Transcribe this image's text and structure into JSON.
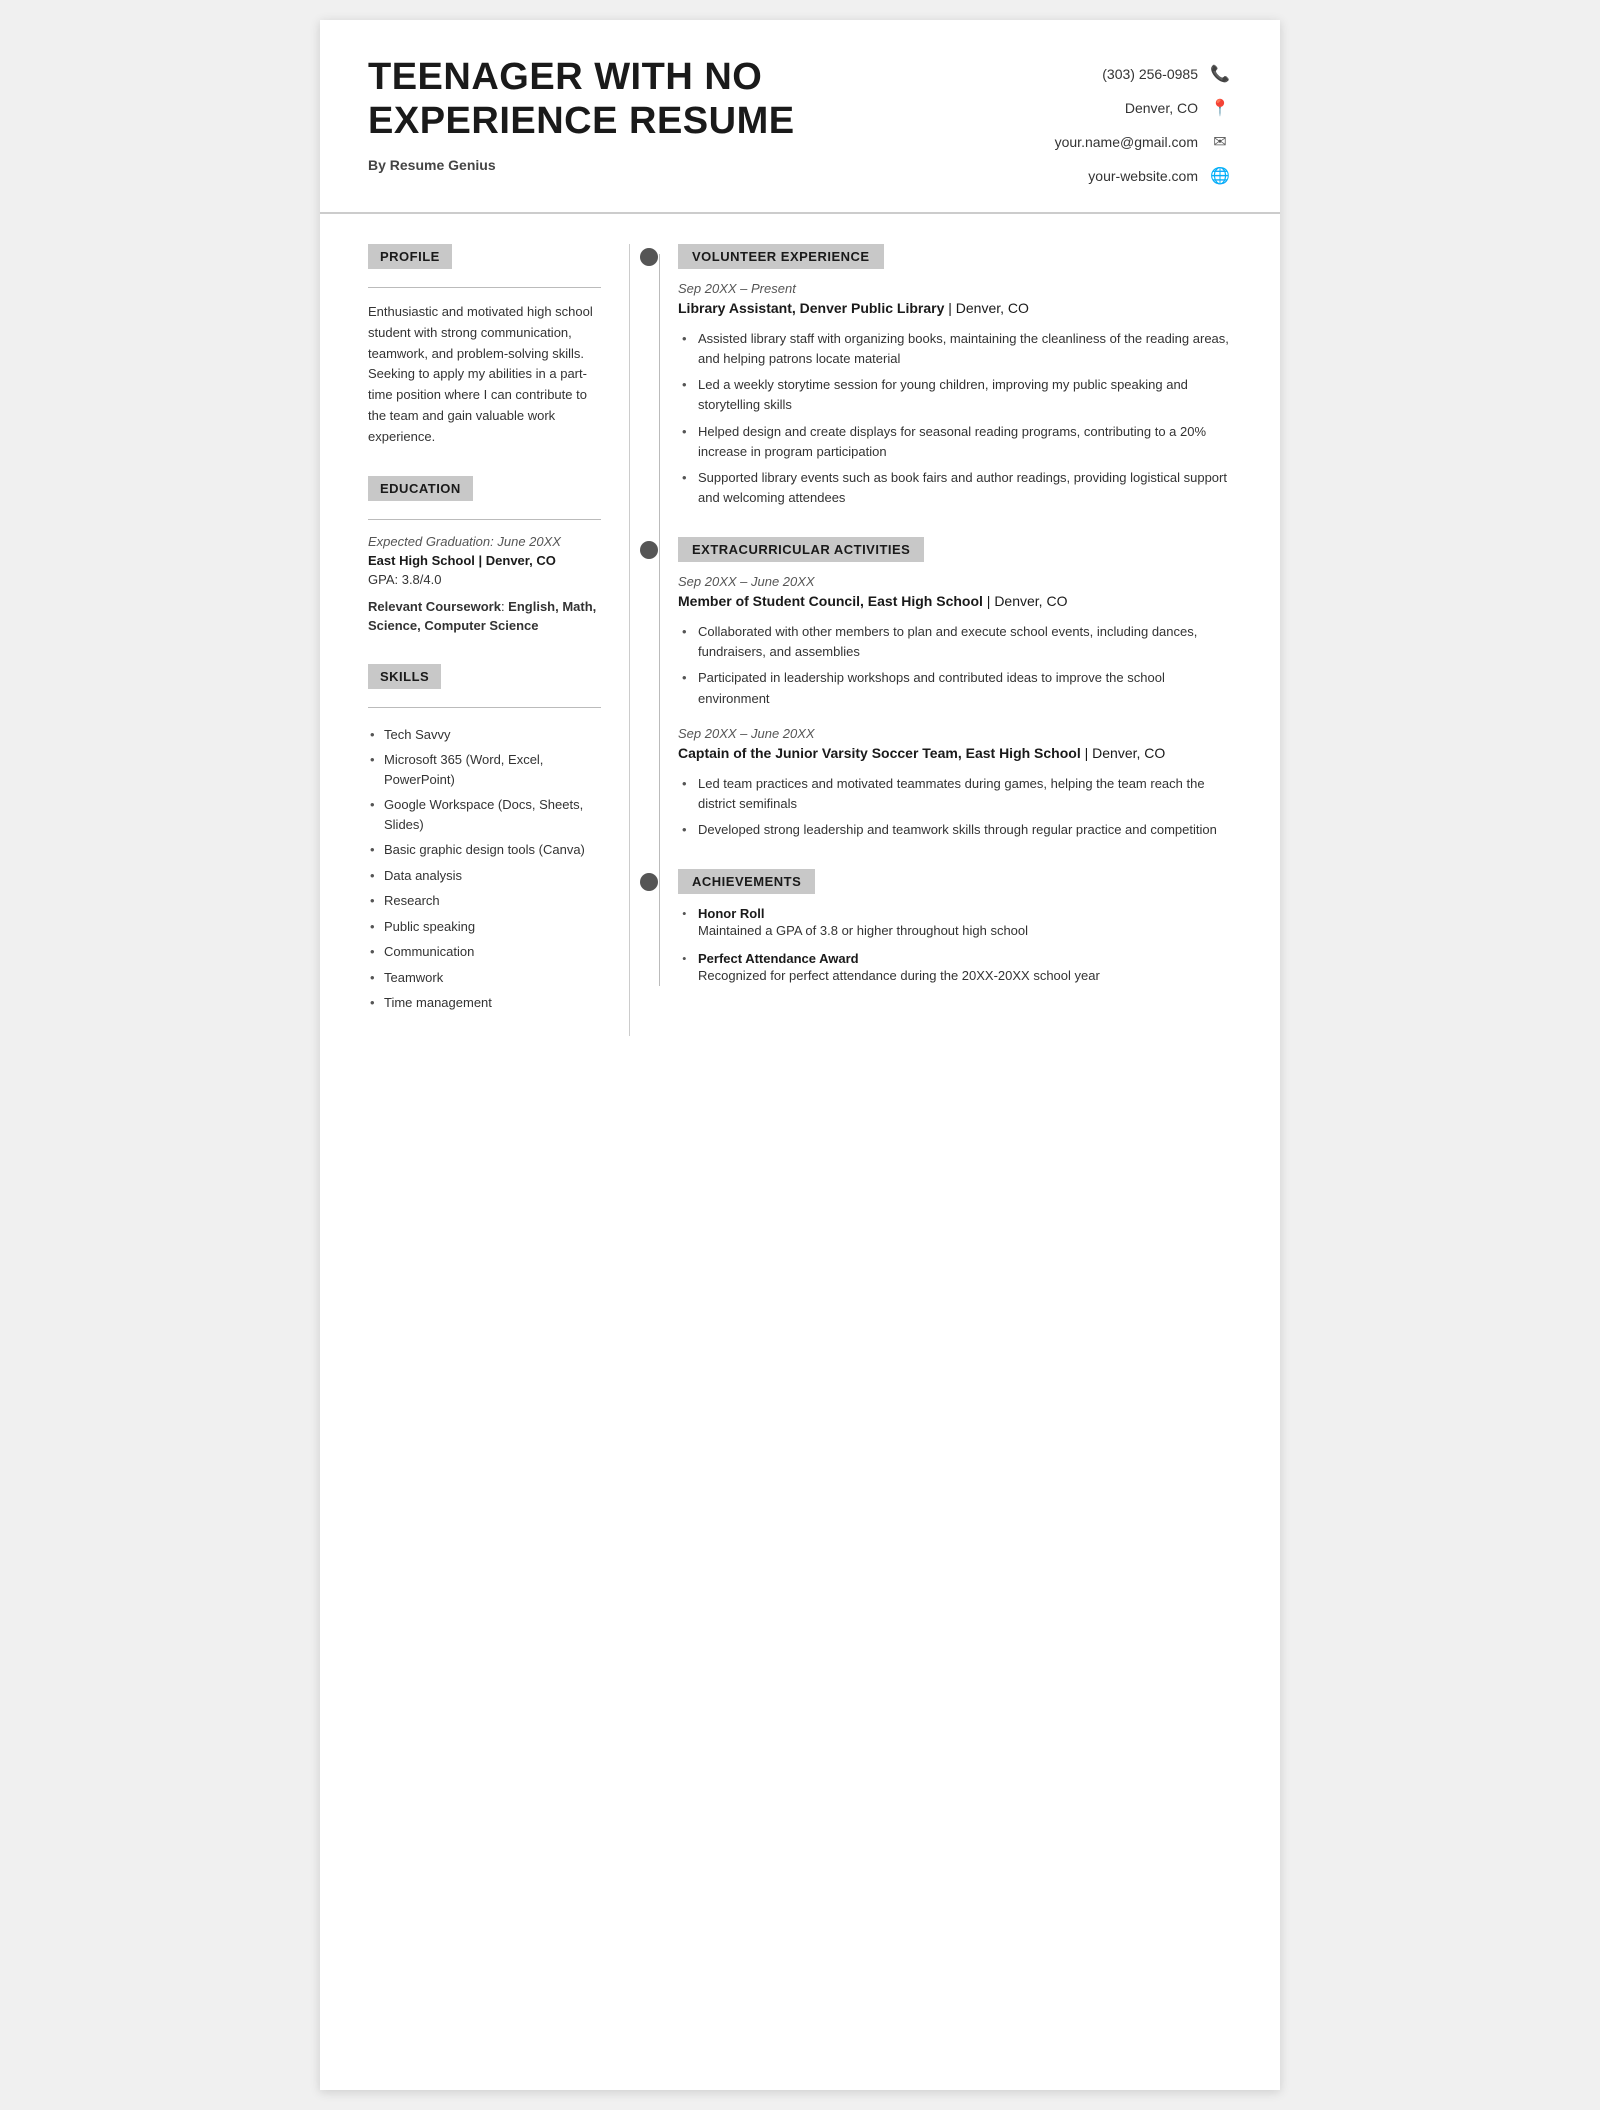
{
  "header": {
    "title": "TEENAGER WITH NO EXPERIENCE RESUME",
    "byline": "By Resume Genius",
    "contact": {
      "phone": "(303) 256-0985",
      "location": "Denver, CO",
      "email": "your.name@gmail.com",
      "website": "your-website.com"
    }
  },
  "profile": {
    "section_label": "PROFILE",
    "text": "Enthusiastic and motivated high school student with strong communication, teamwork, and problem-solving skills. Seeking to apply my abilities in a part-time position where I can contribute to the team and gain valuable work experience."
  },
  "education": {
    "section_label": "EDUCATION",
    "graduation": "Expected Graduation: June 20XX",
    "school": "East High School | Denver, CO",
    "gpa": "GPA: 3.8/4.0",
    "coursework_label": "Relevant Coursework",
    "coursework": "English, Math, Science, Computer Science"
  },
  "skills": {
    "section_label": "SKILLS",
    "items": [
      "Tech Savvy",
      "Microsoft 365 (Word, Excel, PowerPoint)",
      "Google Workspace (Docs, Sheets, Slides)",
      "Basic graphic design tools (Canva)",
      "Data analysis",
      "Research",
      "Public speaking",
      "Communication",
      "Teamwork",
      "Time management"
    ]
  },
  "volunteer": {
    "section_label": "VOLUNTEER EXPERIENCE",
    "entries": [
      {
        "date": "Sep 20XX – Present",
        "title": "Library Assistant, Denver Public Library",
        "location": "Denver, CO",
        "bullets": [
          "Assisted library staff with organizing books, maintaining the cleanliness of the reading areas, and helping patrons locate material",
          "Led a weekly storytime session for young children, improving my public speaking and storytelling skills",
          "Helped design and create displays for seasonal reading programs, contributing to a 20% increase in program participation",
          "Supported library events such as book fairs and author readings, providing logistical support and welcoming attendees"
        ]
      }
    ]
  },
  "extracurricular": {
    "section_label": "EXTRACURRICULAR ACTIVITIES",
    "entries": [
      {
        "date": "Sep 20XX – June 20XX",
        "title": "Member of Student Council, East High School",
        "location": "Denver, CO",
        "bullets": [
          "Collaborated with other members to plan and execute school events, including dances, fundraisers, and assemblies",
          "Participated in leadership workshops and contributed ideas to improve the school environment"
        ]
      },
      {
        "date": "Sep 20XX – June 20XX",
        "title": "Captain of the Junior Varsity Soccer Team, East High School",
        "location": "Denver, CO",
        "bullets": [
          "Led team practices and motivated teammates during games, helping the team reach the district semifinals",
          "Developed strong leadership and teamwork skills through regular practice and competition"
        ]
      }
    ]
  },
  "achievements": {
    "section_label": "ACHIEVEMENTS",
    "items": [
      {
        "title": "Honor Roll",
        "desc": "Maintained a GPA of 3.8 or higher throughout high school"
      },
      {
        "title": "Perfect Attendance Award",
        "desc": "Recognized for perfect attendance during the 20XX-20XX school year"
      }
    ]
  }
}
